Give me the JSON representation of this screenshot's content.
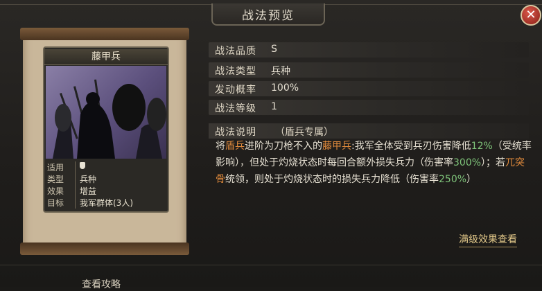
{
  "window": {
    "title": "战法预览",
    "close_glyph": "✕"
  },
  "card": {
    "name": "藤甲兵",
    "attributes": [
      {
        "key": "适用",
        "value": "",
        "icon": "shield-icon"
      },
      {
        "key": "类型",
        "value": "兵种"
      },
      {
        "key": "效果",
        "value": "增益"
      },
      {
        "key": "目标",
        "value": "我军群体(3人)"
      }
    ]
  },
  "info": {
    "quality": {
      "label": "战法品质",
      "value": "S"
    },
    "type": {
      "label": "战法类型",
      "value": "兵种"
    },
    "rate": {
      "label": "发动概率",
      "value": "100%"
    },
    "level": {
      "label": "战法等级",
      "value": "1"
    },
    "description": {
      "label": "战法说明",
      "tag": "（盾兵专属）",
      "parts": [
        "将",
        "盾兵",
        "进阶为刀枪不入的",
        "藤甲兵",
        ":我军全体受到兵刃伤害降低",
        "12%",
        "（受统率影响），但处于灼烧状态时每回合额外损失兵力（伤害率",
        "300%",
        "）；若",
        "兀突骨",
        "统领，则处于灼烧状态时的损失兵力降低（伤害率",
        "250%",
        "）"
      ]
    }
  },
  "links": {
    "max_level_effects": "满级效果查看",
    "guide": "查看攻略"
  },
  "colors": {
    "highlight_orange": "#e08a3c",
    "highlight_green": "#7fc47a"
  }
}
